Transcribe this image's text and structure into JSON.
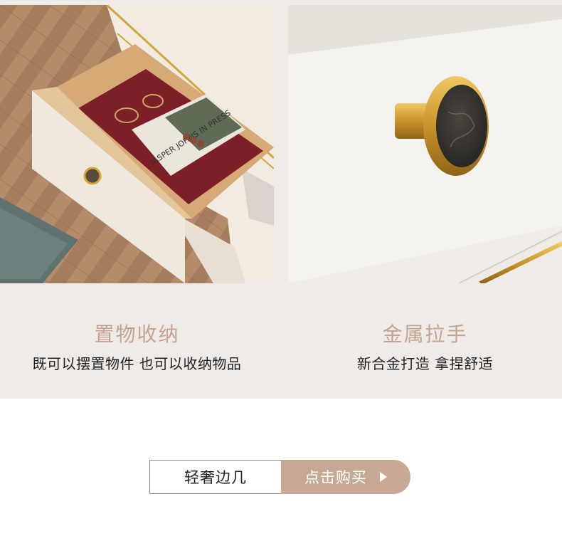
{
  "features": [
    {
      "title": "置物收纳",
      "description": "既可以摆置物件 也可以收纳物品",
      "image_icon": "open-drawer-photo",
      "book_text": "JASPER JOHNS IN PRESS"
    },
    {
      "title": "金属拉手",
      "description": "新合金打造 拿捏舒适",
      "image_icon": "metal-knob-photo"
    }
  ],
  "cta": {
    "product_name": "轻奢边几",
    "buy_label": "点击购买",
    "arrow_icon": "play-arrow-icon"
  },
  "colors": {
    "band": "#eeebe9",
    "accent": "#c7a993",
    "title": "#c4a48f",
    "gold": "#d4a63a"
  }
}
